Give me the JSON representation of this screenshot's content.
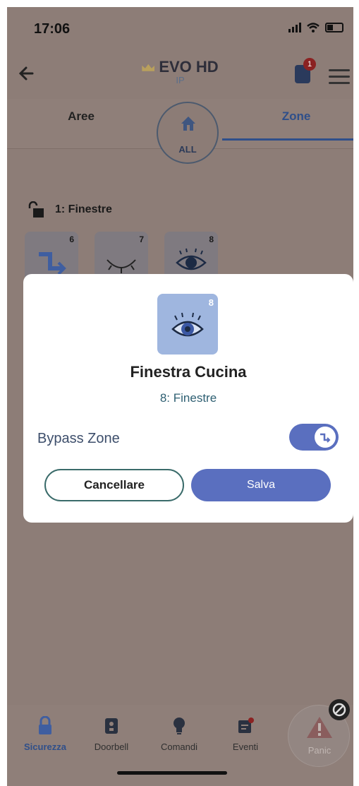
{
  "status": {
    "time": "17:06"
  },
  "header": {
    "title": "EVO HD",
    "subtitle": "IP",
    "notification_count": "1"
  },
  "tabs": {
    "left": "Aree",
    "right": "Zone",
    "center": "ALL"
  },
  "area": {
    "label": "1: Finestre"
  },
  "tiles": [
    {
      "num": "6",
      "icon": "bypass-icon"
    },
    {
      "num": "7",
      "icon": "eye-closed-icon"
    },
    {
      "num": "8",
      "icon": "eye-icon"
    }
  ],
  "modal": {
    "tile_num": "8",
    "title": "Finestra Cucina",
    "subtitle": "8: Finestre",
    "bypass_label": "Bypass Zone",
    "bypass_on": true,
    "cancel_label": "Cancellare",
    "save_label": "Salva"
  },
  "nav": {
    "items": [
      {
        "label": "Sicurezza",
        "icon": "padlock-icon"
      },
      {
        "label": "Doorbell",
        "icon": "doorbell-icon"
      },
      {
        "label": "Comandi",
        "icon": "bulb-icon"
      },
      {
        "label": "Eventi",
        "icon": "events-icon"
      }
    ],
    "panic_label": "Panic"
  },
  "colors": {
    "accent": "#5a6fbf",
    "overlay": "#8d7d77",
    "tab_active": "#2f4f8a"
  }
}
